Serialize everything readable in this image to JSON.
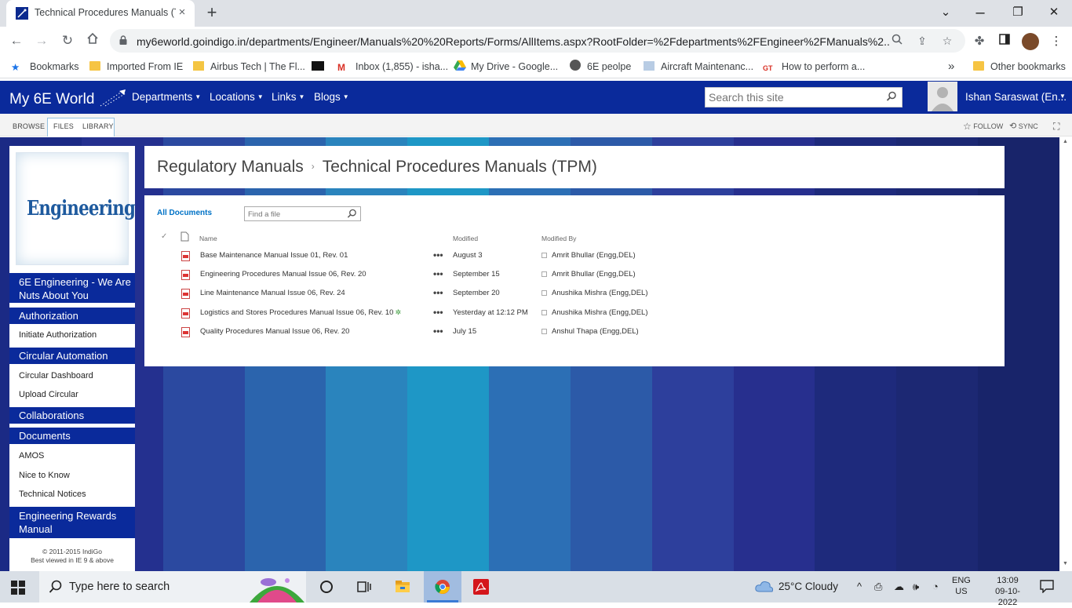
{
  "browser": {
    "tab_title": "Technical Procedures Manuals (TPM)",
    "tab_close": "×",
    "new_tab": "+",
    "window_minimize": "⌄",
    "window_restore": "❐",
    "window_close": "✕",
    "url": "my6eworld.goindigo.in/departments/Engineer/Manuals%20%20Reports/Forms/AllItems.aspx?RootFolder=%2Fdepartments%2FEngineer%2FManuals%2...",
    "bookmarks": [
      {
        "label": "Bookmarks",
        "icon": "star-icon"
      },
      {
        "label": "Imported From IE",
        "icon": "folder-icon"
      },
      {
        "label": "Airbus Tech | The Fl...",
        "icon": "airbus-icon"
      },
      {
        "label": "",
        "icon": "dark-site-icon"
      },
      {
        "label": "Inbox (1,855) - isha...",
        "icon": "gmail-icon"
      },
      {
        "label": "My Drive - Google...",
        "icon": "drive-icon"
      },
      {
        "label": "6E peolpe",
        "icon": "globe-icon"
      },
      {
        "label": "Aircraft Maintenanc...",
        "icon": "page-icon"
      },
      {
        "label": "How to perform a...",
        "icon": "gt-icon"
      }
    ],
    "bookmarks_overflow": "»",
    "other_bookmarks": "Other bookmarks"
  },
  "sharepoint": {
    "logo": "My 6E World",
    "nav": [
      "Departments",
      "Locations",
      "Links",
      "Blogs"
    ],
    "search_placeholder": "Search this site",
    "user_name": "Ishan Saraswat (En...",
    "ribbon_tabs": [
      "BROWSE",
      "FILES",
      "LIBRARY"
    ],
    "follow": "FOLLOW",
    "sync": "SYNC"
  },
  "leftnav": {
    "logo_text": "Engineering",
    "items": [
      {
        "label": "6E Engineering - We Are Nuts About You",
        "type": "head"
      },
      {
        "label": "Authorization",
        "type": "head"
      },
      {
        "label": "Initiate Authorization",
        "type": "item"
      },
      {
        "label": "Circular Automation",
        "type": "head"
      },
      {
        "label": "Circular Dashboard",
        "type": "item"
      },
      {
        "label": "Upload Circular",
        "type": "item"
      },
      {
        "label": "Collaborations",
        "type": "head"
      },
      {
        "label": "Documents",
        "type": "head"
      },
      {
        "label": "AMOS",
        "type": "item"
      },
      {
        "label": "Nice to Know",
        "type": "item"
      },
      {
        "label": "Technical Notices",
        "type": "item"
      },
      {
        "label": "Engineering Rewards Manual",
        "type": "head"
      }
    ],
    "copyright_line1": "© 2011-2015 IndiGo",
    "copyright_line2": "Best viewed in IE 9 & above"
  },
  "page": {
    "breadcrumb_parent": "Regulatory Manuals",
    "breadcrumb_sep": "›",
    "breadcrumb_current": "Technical Procedures Manuals (TPM)",
    "view_name": "All Documents",
    "find_placeholder": "Find a file",
    "columns": {
      "name": "Name",
      "modified": "Modified",
      "modified_by": "Modified By"
    },
    "documents": [
      {
        "name": "Base Maintenance Manual Issue 01, Rev. 01",
        "new": "",
        "modified": "August 3",
        "modified_by": "Amrit Bhullar (Engg,DEL)"
      },
      {
        "name": "Engineering Procedures Manual Issue 06, Rev. 20",
        "new": "",
        "modified": "September 15",
        "modified_by": "Amrit Bhullar (Engg,DEL)"
      },
      {
        "name": "Line Maintenance Manual Issue 06, Rev. 24",
        "new": "",
        "modified": "September 20",
        "modified_by": "Anushika Mishra (Engg,DEL)"
      },
      {
        "name": "Logistics and Stores Procedures Manual Issue 06, Rev. 10",
        "new": "✲",
        "modified": "Yesterday at 12:12 PM",
        "modified_by": "Anushika Mishra (Engg,DEL)"
      },
      {
        "name": "Quality Procedures Manual Issue 06, Rev. 20",
        "new": "",
        "modified": "July 15",
        "modified_by": "Anshul Thapa (Engg,DEL)"
      }
    ],
    "ellipsis": "•••"
  },
  "taskbar": {
    "search_text": "Type here to search",
    "weather": "25°C  Cloudy",
    "lang_1": "ENG",
    "lang_2": "US",
    "time": "13:09",
    "date": "09-10-2022"
  },
  "colors": {
    "sp_blue": "#0a2a9b",
    "stripes": [
      "#1b2a85",
      "#24308f",
      "#2b49a0",
      "#2b64ad",
      "#2a84bd",
      "#1e97c6",
      "#2c6fb5",
      "#2c5aa8",
      "#2d3f9c",
      "#272f8e",
      "#1e2a7c",
      "#1c2873",
      "#18246a"
    ]
  }
}
